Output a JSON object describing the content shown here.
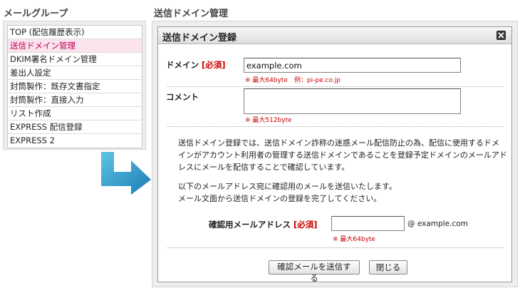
{
  "sidebar": {
    "title": "メールグループ",
    "items": [
      {
        "label": "TOP (配信履歴表示)"
      },
      {
        "label": "送信ドメイン管理"
      },
      {
        "label": "DKIM署名ドメイン管理"
      },
      {
        "label": "差出人設定"
      },
      {
        "label": "封筒製作：既存文書指定"
      },
      {
        "label": "封筒製作：直接入力"
      },
      {
        "label": "リスト作成"
      },
      {
        "label": "EXPRESS 配信登録"
      },
      {
        "label": "EXPRESS 2"
      }
    ],
    "active_index": 1
  },
  "main": {
    "title": "送信ドメイン管理"
  },
  "dialog": {
    "title": "送信ドメイン登録",
    "domain": {
      "label": "ドメイン",
      "required": "[必須]",
      "value": "example.com",
      "note": "※ 最大64byte　例：pi-pe.co.jp"
    },
    "comment": {
      "label": "コメント",
      "value": "",
      "note": "※ 最大512byte"
    },
    "description": {
      "line1": "送信ドメイン登録では、送信ドメイン詐称の迷惑メール配信防止の為、配信に使用するドメ",
      "line2": "インがアカウント利用者の管理する送信ドメインであることを登録予定ドメインのメールアド",
      "line3": "レスにメールを配信することで確認しています。",
      "line4": "以下のメールアドレス宛に確認用のメールを送信いたします。",
      "line5": "メール文面から送信ドメインの登録を完了してください。"
    },
    "confirm": {
      "label": "確認用メールアドレス",
      "required": "[必須]",
      "value": "",
      "suffix": "@ example.com",
      "note": "※ 最大64byte"
    },
    "buttons": {
      "send": "確認メールを送信する",
      "close": "閉じる"
    }
  },
  "colors": {
    "required_red": "#cc0000",
    "active_item_bg": "#fbe4ee",
    "arrow_light": "#5fc3e4",
    "arrow_dark": "#1b7cb4"
  },
  "icons": [
    "close-icon",
    "arrow-icon"
  ]
}
